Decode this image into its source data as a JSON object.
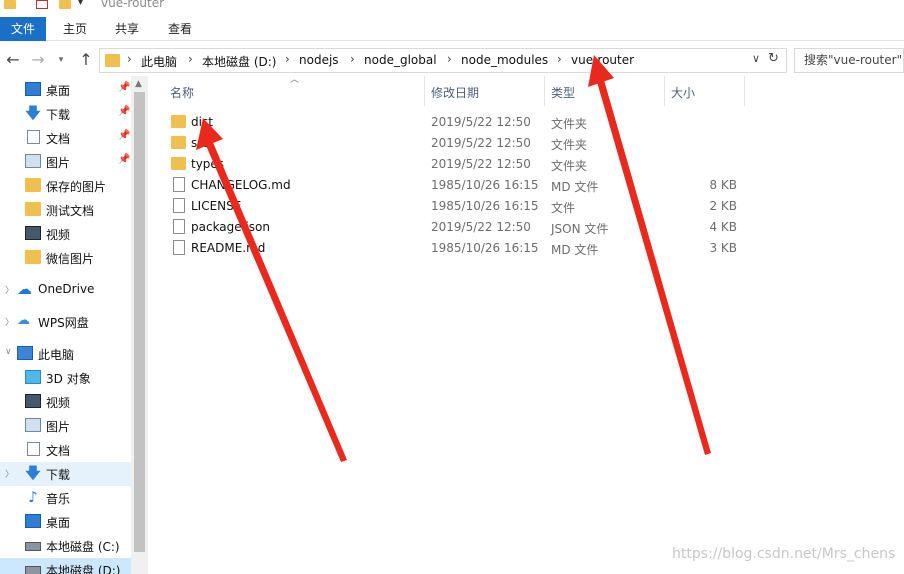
{
  "window": {
    "title": "vue-router"
  },
  "ribbon": {
    "tabs": [
      "文件",
      "主页",
      "共享",
      "查看"
    ]
  },
  "nav": {
    "back_icon": "←",
    "forward_icon": "→",
    "recent_icon": "▾",
    "up_icon": "↑",
    "breadcrumbs": [
      "此电脑",
      "本地磁盘 (D:)",
      "nodejs",
      "node_global",
      "node_modules",
      "vue-router"
    ],
    "separator": "›",
    "dropdown_icon": "∨",
    "refresh_icon": "↻",
    "search_placeholder": "搜索\"vue-router\""
  },
  "sidebar": {
    "pin": "📌",
    "items": [
      {
        "label": "桌面",
        "icon": "desktop-icon",
        "pinned": true
      },
      {
        "label": "下载",
        "icon": "download-icon",
        "pinned": true
      },
      {
        "label": "文档",
        "icon": "document-icon",
        "pinned": true
      },
      {
        "label": "图片",
        "icon": "picture-icon",
        "pinned": true
      },
      {
        "label": "保存的图片",
        "icon": "folder-icon"
      },
      {
        "label": "测试文档",
        "icon": "folder-icon"
      },
      {
        "label": "视频",
        "icon": "video-icon"
      },
      {
        "label": "微信图片",
        "icon": "folder-icon"
      },
      {
        "label": "OneDrive",
        "icon": "onedrive-icon"
      },
      {
        "label": "WPS网盘",
        "icon": "wps-cloud-icon"
      },
      {
        "label": "此电脑",
        "icon": "computer-icon"
      },
      {
        "label": "3D 对象",
        "icon": "3d-objects-icon"
      },
      {
        "label": "视频",
        "icon": "video-icon"
      },
      {
        "label": "图片",
        "icon": "picture-icon"
      },
      {
        "label": "文档",
        "icon": "document-icon"
      },
      {
        "label": "下载",
        "icon": "download-icon"
      },
      {
        "label": "音乐",
        "icon": "music-icon"
      },
      {
        "label": "桌面",
        "icon": "desktop-icon"
      },
      {
        "label": "本地磁盘 (C:)",
        "icon": "drive-icon"
      },
      {
        "label": "本地磁盘 (D:)",
        "icon": "drive-icon"
      }
    ]
  },
  "columns": {
    "name": "名称",
    "modified": "修改日期",
    "type": "类型",
    "size": "大小"
  },
  "files": [
    {
      "name": "dist",
      "modified": "2019/5/22 12:50",
      "type": "文件夹",
      "size": "",
      "kind": "folder"
    },
    {
      "name": "src",
      "modified": "2019/5/22 12:50",
      "type": "文件夹",
      "size": "",
      "kind": "folder"
    },
    {
      "name": "types",
      "modified": "2019/5/22 12:50",
      "type": "文件夹",
      "size": "",
      "kind": "folder"
    },
    {
      "name": "CHANGELOG.md",
      "modified": "1985/10/26 16:15",
      "type": "MD 文件",
      "size": "8 KB",
      "kind": "file"
    },
    {
      "name": "LICENSE",
      "modified": "1985/10/26 16:15",
      "type": "文件",
      "size": "2 KB",
      "kind": "file"
    },
    {
      "name": "package.json",
      "modified": "2019/5/22 12:50",
      "type": "JSON 文件",
      "size": "4 KB",
      "kind": "file"
    },
    {
      "name": "README.md",
      "modified": "1985/10/26 16:15",
      "type": "MD 文件",
      "size": "3 KB",
      "kind": "file"
    }
  ],
  "watermark": "https://blog.csdn.net/Mrs_chens",
  "annotation_color": "#e8291c"
}
